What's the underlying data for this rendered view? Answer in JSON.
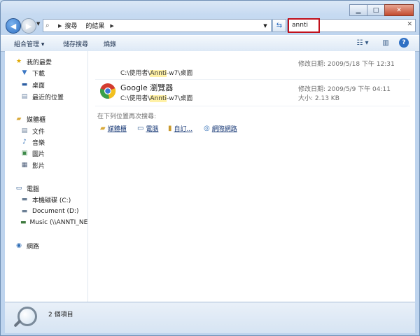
{
  "nav": {
    "address_crumbs": [
      "搜尋",
      "的結果"
    ]
  },
  "search": {
    "value": "annti"
  },
  "toolbar": {
    "organize": "組合管理",
    "save_search": "儲存搜尋",
    "burn": "燒錄"
  },
  "sidebar": {
    "favorites_header": "我的最愛",
    "favorites": [
      "下載",
      "桌面",
      "最近的位置"
    ],
    "libraries_header": "媒體櫃",
    "libraries": [
      "文件",
      "音樂",
      "圖片",
      "影片"
    ],
    "computer_header": "電腦",
    "drives": [
      "本機磁碟 (C:)",
      "Document (D:)",
      "Music (\\\\ANNTI_NE"
    ],
    "network_header": "網路"
  },
  "results": [
    {
      "title": "",
      "path_prefix": "C:\\使用者\\",
      "path_match": "Annti",
      "path_suffix": "-w7\\桌面",
      "modified": "修改日期: 2009/5/18 下午 12:31",
      "size": ""
    },
    {
      "title": "Google 瀏覽器",
      "path_prefix": "C:\\使用者\\",
      "path_match": "Annti",
      "path_suffix": "-w7\\桌面",
      "modified": "修改日期: 2009/5/9 下午 04:11",
      "size": "大小: 2.13 KB"
    }
  ],
  "search_again": {
    "label": "在下列位置再次搜尋:",
    "locations": [
      "媒體櫃",
      "電腦",
      "自訂...",
      "網際網路"
    ]
  },
  "status": {
    "item_count": "2 個項目"
  },
  "icons": {
    "back": "back-arrow-icon",
    "forward": "forward-arrow-icon",
    "refresh": "refresh-icon",
    "clear": "close-icon",
    "view": "view-options-icon",
    "preview": "preview-pane-icon",
    "help": "help-icon",
    "chrome": "chrome-icon",
    "magnifier": "magnifier-icon"
  },
  "colors": {
    "search_highlight_border": "#c0101b",
    "match_highlight": "#fff1a6",
    "window_frame": "#c6daf1"
  }
}
